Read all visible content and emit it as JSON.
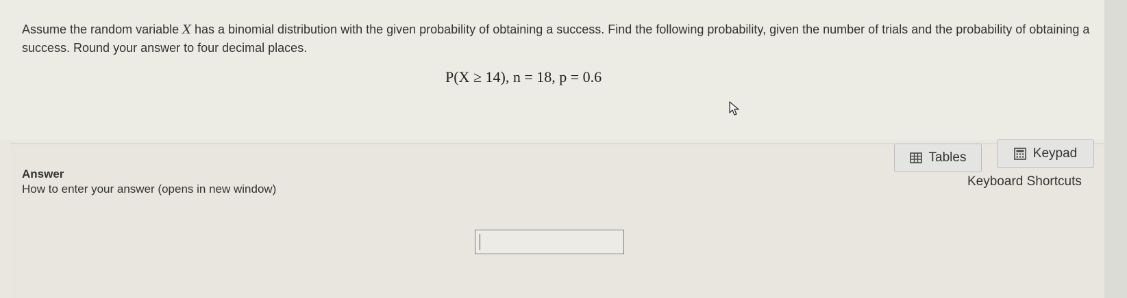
{
  "question": {
    "prompt_before_var": "Assume the random variable ",
    "variable": "X",
    "prompt_after_var": " has a binomial distribution with the given probability of obtaining a success. Find the following probability, given the number of trials and the probability of obtaining a success. Round your answer to four decimal places.",
    "equation": "P(X ≥ 14), n = 18, p = 0.6"
  },
  "answer": {
    "heading": "Answer",
    "howto_link": "How to enter your answer (opens in new window)",
    "input_value": ""
  },
  "tools": {
    "tables_label": "Tables",
    "keypad_label": "Keypad",
    "shortcuts_label": "Keyboard Shortcuts"
  },
  "icons": {
    "tables": "table-grid-icon",
    "keypad": "calculator-icon",
    "cursor": "mouse-pointer-icon"
  }
}
